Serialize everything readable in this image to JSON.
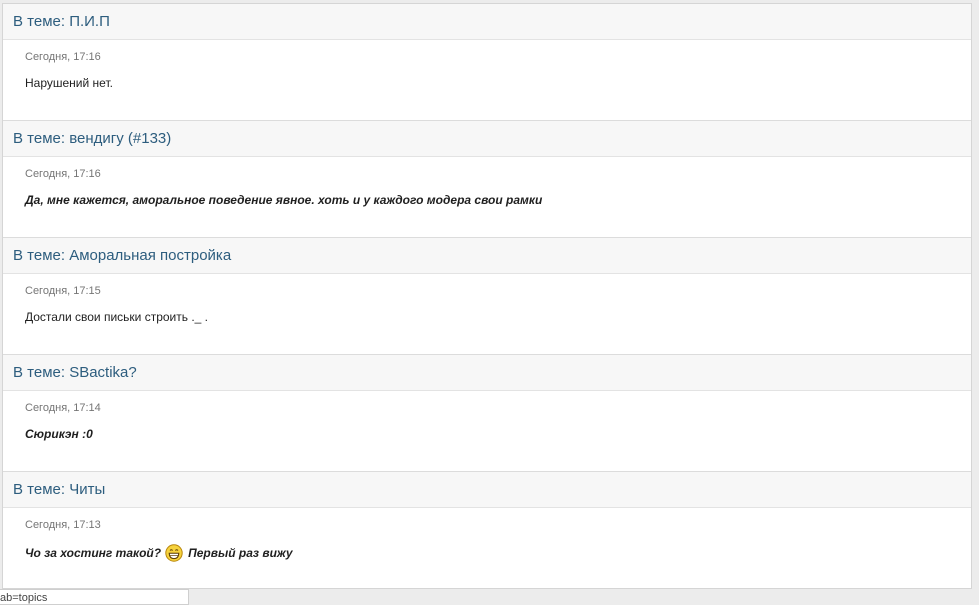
{
  "posts": [
    {
      "title": "В теме: П.И.П",
      "time": "Сегодня, 17:16",
      "text": "Нарушений нет."
    },
    {
      "title": "В теме: вендигу (#133)",
      "time": "Сегодня, 17:16",
      "text": "Да, мне кажется, аморальное поведение явное. хоть и у каждого модера свои рамки"
    },
    {
      "title": "В теме: Аморальная постройка",
      "time": "Сегодня, 17:15",
      "text": "Достали свои письки строить ._ ."
    },
    {
      "title": "В теме: SBactika?",
      "time": "Сегодня, 17:14",
      "text": "Сюрикэн :0"
    },
    {
      "title": "В теме: Читы",
      "time": "Сегодня, 17:13",
      "text_before": "Чо за хостинг такой?",
      "text_after": "Первый раз вижу",
      "icon": "grin-smiley-icon"
    }
  ],
  "status_url": "ab=topics"
}
